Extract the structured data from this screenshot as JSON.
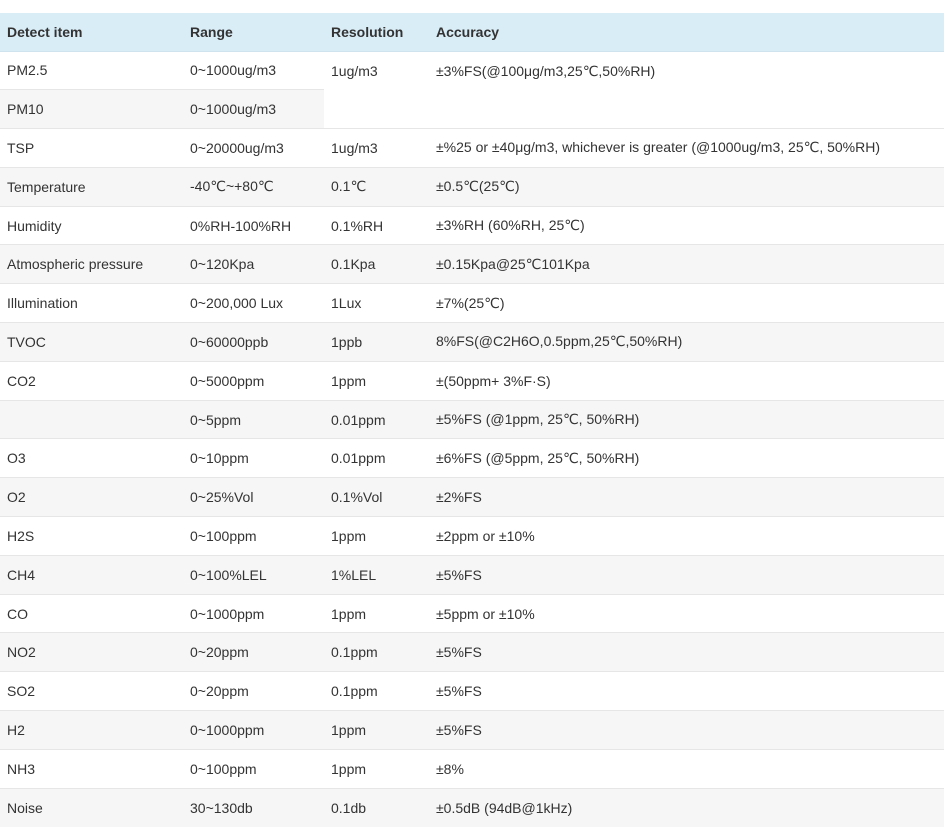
{
  "table": {
    "headers": [
      "Detect item",
      "Range",
      "Resolution",
      "Accuracy"
    ],
    "rows": [
      {
        "item": "PM2.5",
        "range": "0~1000ug/m3",
        "resolution": "1ug/m3",
        "accuracy": "±3%FS(@100μg/m3,25℃,50%RH)"
      },
      {
        "item": "PM10",
        "range": "0~1000ug/m3",
        "resolution": "",
        "accuracy": ""
      },
      {
        "item": "TSP",
        "range": "0~20000ug/m3",
        "resolution": "1ug/m3",
        "accuracy": "±%25 or ±40μg/m3, whichever is greater (@1000ug/m3, 25℃, 50%RH)"
      },
      {
        "item": "Temperature",
        "range": "-40℃~+80℃",
        "resolution": "0.1℃",
        "accuracy": "±0.5℃(25℃)"
      },
      {
        "item": "Humidity",
        "range": "0%RH-100%RH",
        "resolution": "0.1%RH",
        "accuracy": "±3%RH (60%RH, 25℃)"
      },
      {
        "item": "Atmospheric pressure",
        "range": "0~120Kpa",
        "resolution": "0.1Kpa",
        "accuracy": "±0.15Kpa@25℃101Kpa"
      },
      {
        "item": "Illumination",
        "range": "0~200,000 Lux",
        "resolution": "1Lux",
        "accuracy": "±7%(25℃)"
      },
      {
        "item": "TVOC",
        "range": "0~60000ppb",
        "resolution": "1ppb",
        "accuracy": "8%FS(@C2H6O,0.5ppm,25℃,50%RH)"
      },
      {
        "item": "CO2",
        "range": "0~5000ppm",
        "resolution": "1ppm",
        "accuracy": "±(50ppm+ 3%F·S)"
      },
      {
        "item": "",
        "range": "0~5ppm",
        "resolution": "0.01ppm",
        "accuracy": "±5%FS (@1ppm, 25℃, 50%RH)"
      },
      {
        "item": "O3",
        "range": "0~10ppm",
        "resolution": "0.01ppm",
        "accuracy": "±6%FS (@5ppm, 25℃, 50%RH)"
      },
      {
        "item": "O2",
        "range": "0~25%Vol",
        "resolution": "0.1%Vol",
        "accuracy": "±2%FS"
      },
      {
        "item": "H2S",
        "range": "0~100ppm",
        "resolution": "1ppm",
        "accuracy": "±2ppm or ±10%"
      },
      {
        "item": "CH4",
        "range": "0~100%LEL",
        "resolution": "1%LEL",
        "accuracy": "±5%FS"
      },
      {
        "item": "CO",
        "range": "0~1000ppm",
        "resolution": "1ppm",
        "accuracy": "±5ppm or ±10%"
      },
      {
        "item": "NO2",
        "range": "0~20ppm",
        "resolution": "0.1ppm",
        "accuracy": "±5%FS"
      },
      {
        "item": "SO2",
        "range": "0~20ppm",
        "resolution": "0.1ppm",
        "accuracy": "±5%FS"
      },
      {
        "item": "H2",
        "range": "0~1000ppm",
        "resolution": "1ppm",
        "accuracy": "±5%FS"
      },
      {
        "item": "NH3",
        "range": "0~100ppm",
        "resolution": "1ppm",
        "accuracy": "±8%"
      },
      {
        "item": "Noise",
        "range": "30~130db",
        "resolution": "0.1db",
        "accuracy": "±0.5dB (94dB@1kHz)"
      }
    ]
  },
  "colors": {
    "header_background": "#d9edf7",
    "row_alt_background": "#f6f6f6",
    "text": "#333333"
  }
}
